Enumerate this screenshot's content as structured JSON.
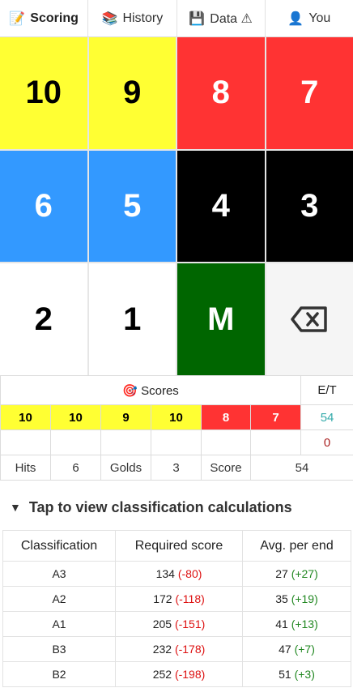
{
  "tabs": [
    {
      "icon": "📝",
      "label": "Scoring"
    },
    {
      "icon": "📚",
      "label": "History"
    },
    {
      "icon": "💾",
      "label": "Data ⚠"
    },
    {
      "icon": "👤",
      "label": "You"
    }
  ],
  "keypad": [
    "10",
    "9",
    "8",
    "7",
    "6",
    "5",
    "4",
    "3",
    "2",
    "1",
    "M",
    "⌫"
  ],
  "scores": {
    "header": {
      "icon": "🎯",
      "label": "Scores",
      "et_label": "E/T"
    },
    "end_scores": [
      "10",
      "10",
      "9",
      "10",
      "8",
      "7"
    ],
    "et_value": "54",
    "et_zero": "0",
    "summary": {
      "hits_label": "Hits",
      "hits": "6",
      "golds_label": "Golds",
      "golds": "3",
      "score_label": "Score",
      "score": "54"
    }
  },
  "classification": {
    "toggle_icon": "▼",
    "toggle_label": "Tap to view classification calculations",
    "headers": [
      "Classification",
      "Required score",
      "Avg. per end"
    ],
    "rows": [
      {
        "name": "A3",
        "required": "134",
        "required_diff": "(-80)",
        "avg": "27",
        "avg_diff": "(+27)"
      },
      {
        "name": "A2",
        "required": "172",
        "required_diff": "(-118)",
        "avg": "35",
        "avg_diff": "(+19)"
      },
      {
        "name": "A1",
        "required": "205",
        "required_diff": "(-151)",
        "avg": "41",
        "avg_diff": "(+13)"
      },
      {
        "name": "B3",
        "required": "232",
        "required_diff": "(-178)",
        "avg": "47",
        "avg_diff": "(+7)"
      },
      {
        "name": "B2",
        "required": "252",
        "required_diff": "(-198)",
        "avg": "51",
        "avg_diff": "(+3)"
      }
    ]
  },
  "colors": {
    "yellow": "#ffff33",
    "red": "#ff3333",
    "blue": "#3399ff",
    "black": "#000000",
    "green": "#006600",
    "et": "#33aaaa",
    "negative": "#dd1111",
    "positive": "#228822"
  }
}
